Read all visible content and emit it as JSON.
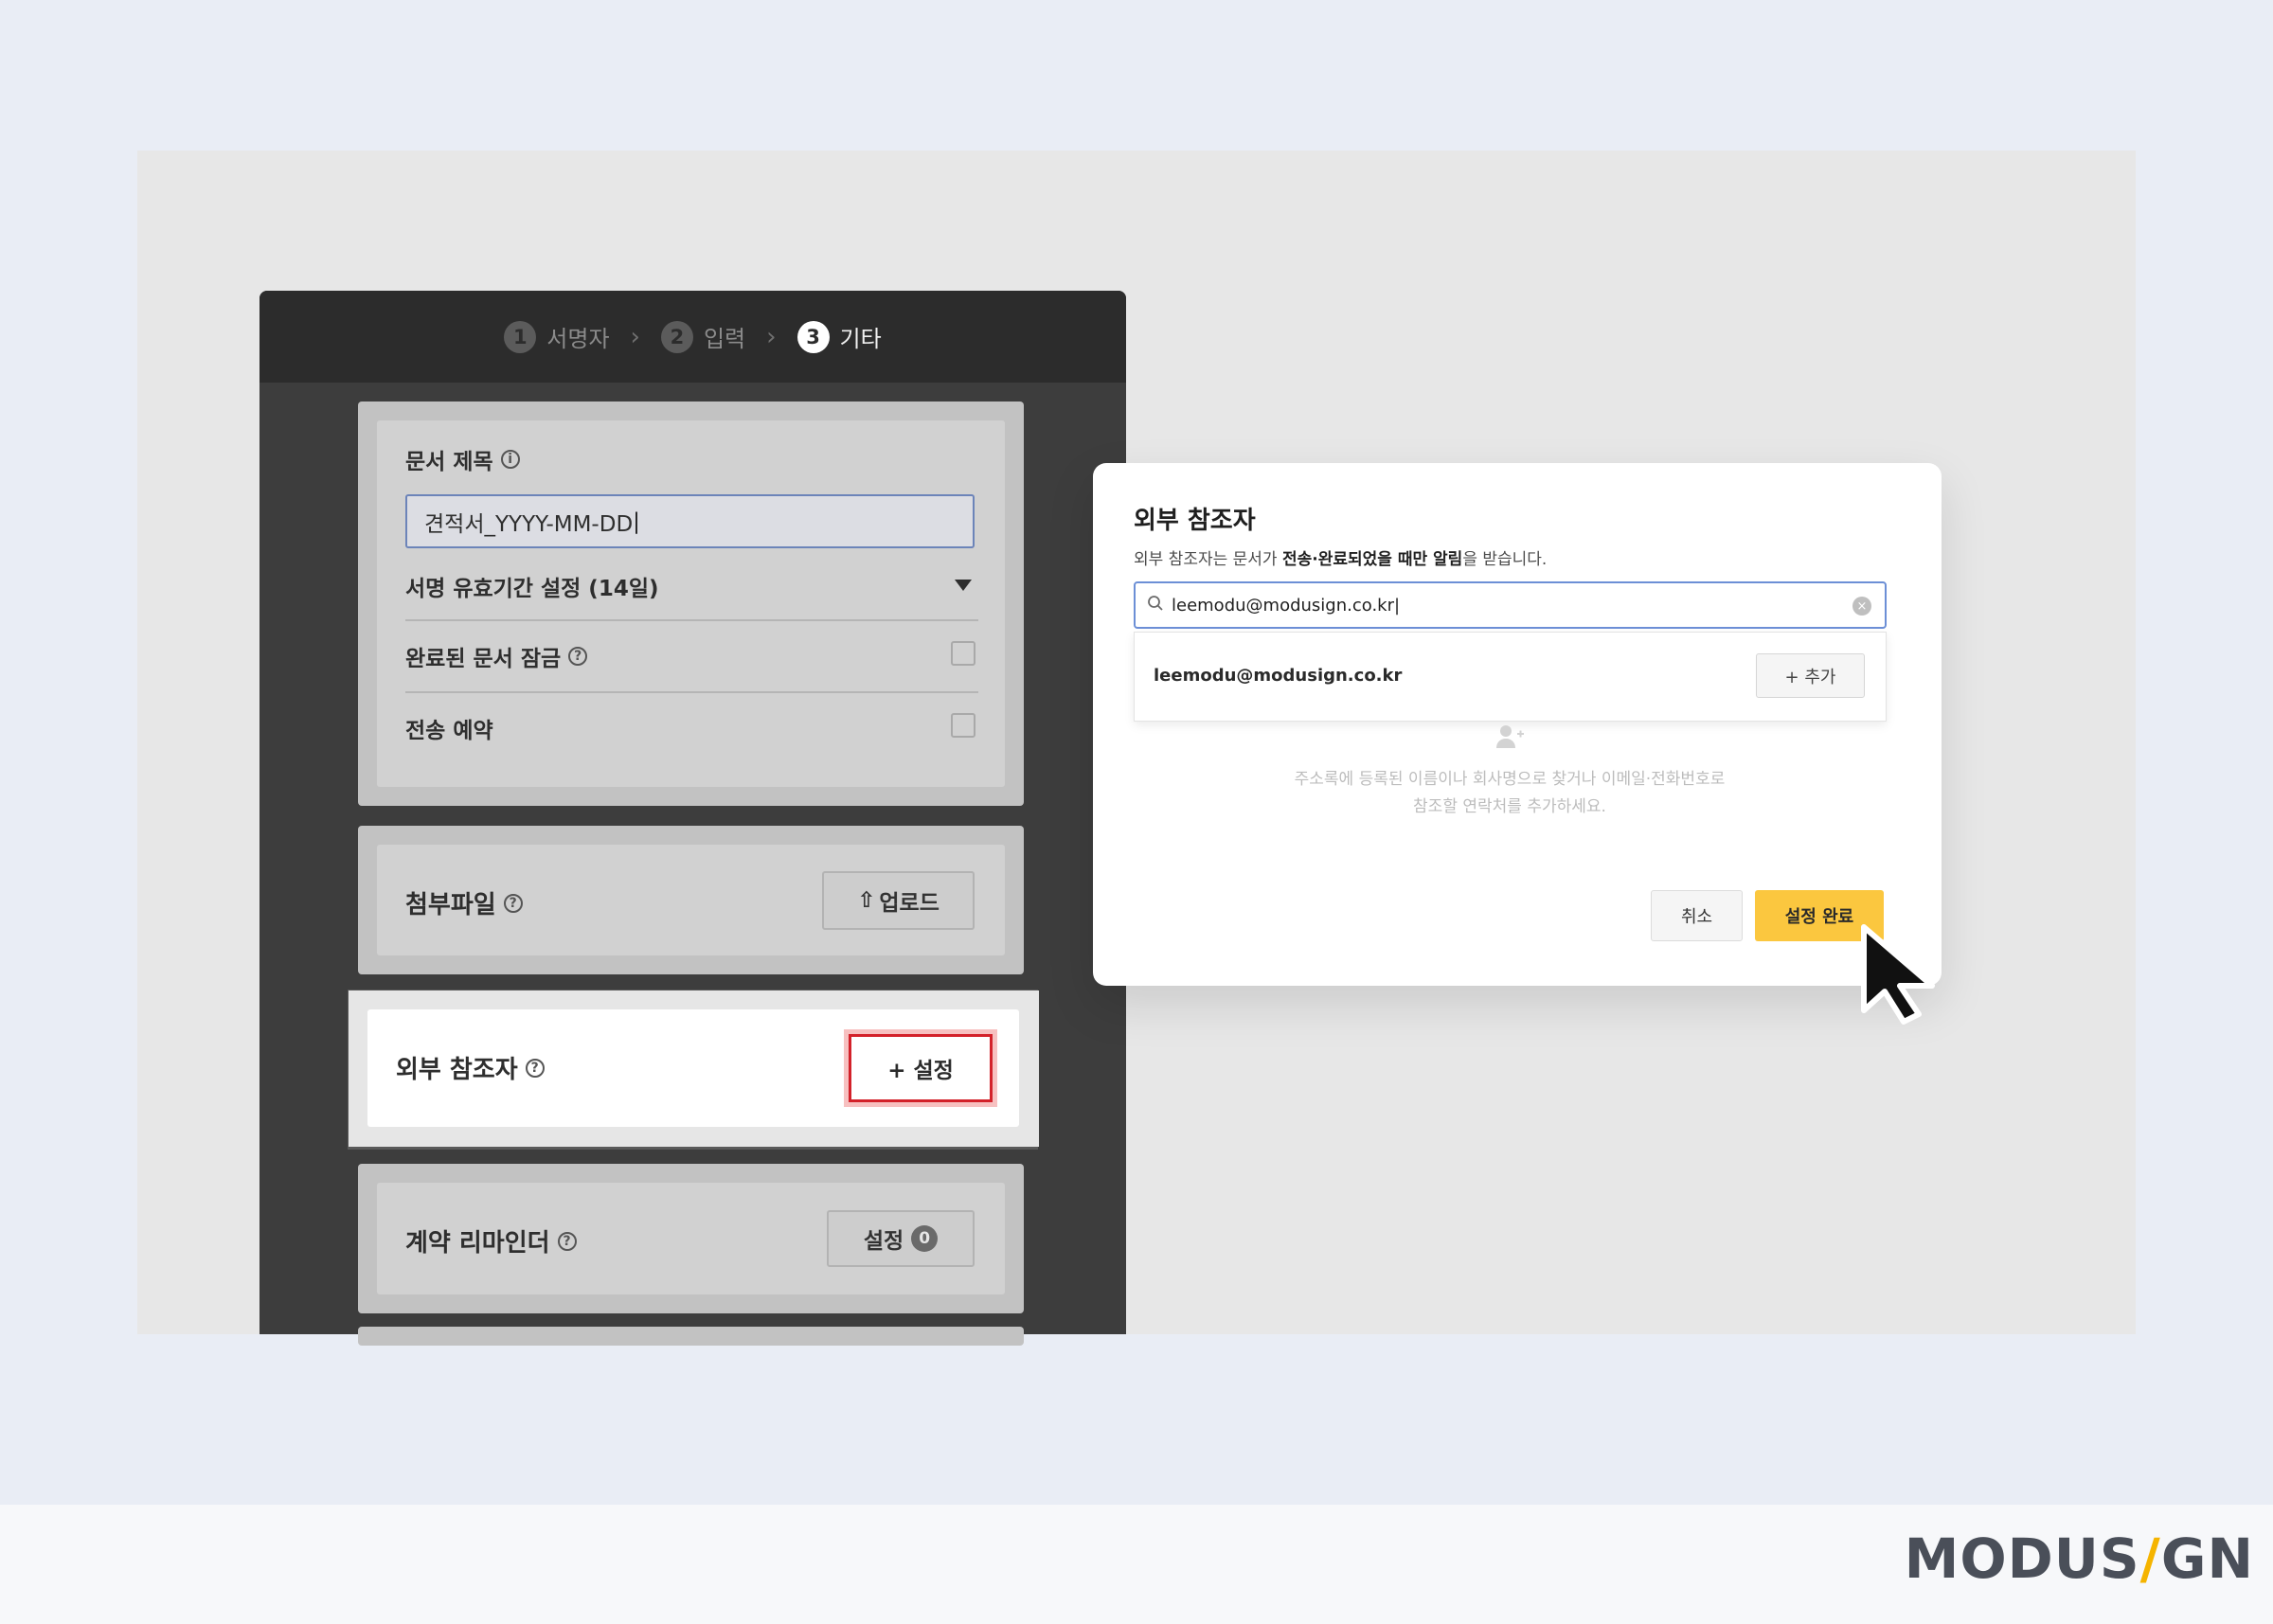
{
  "steps": [
    {
      "num": "1",
      "label": "서명자"
    },
    {
      "num": "2",
      "label": "입력"
    },
    {
      "num": "3",
      "label": "기타"
    }
  ],
  "doc_title": {
    "label": "문서 제목",
    "value": "견적서_YYYY-MM-DD"
  },
  "expiry": {
    "label": "서명 유효기간 설정 (14일)"
  },
  "lock_completed": {
    "label": "완료된 문서 잠금"
  },
  "schedule_send": {
    "label": "전송 예약"
  },
  "attachment": {
    "label": "첨부파일",
    "button": "업로드"
  },
  "external_ref": {
    "label": "외부 참조자",
    "button": "+ 설정"
  },
  "reminder": {
    "label": "계약 리마인더",
    "button": "설정",
    "count": "0"
  },
  "modal": {
    "title": "외부 참조자",
    "desc_prefix": "외부 참조자는 문서가 ",
    "desc_bold": "전송·완료되었을 때만 알림",
    "desc_suffix": "을 받습니다.",
    "search_value": "leemodu@modusign.co.kr",
    "result_email": "leemodu@modusign.co.kr",
    "add_button": "+ 추가",
    "empty_line1": "주소록에 등록된 이름이나 회사명으로 찾거나 이메일·전화번호로",
    "empty_line2": "참조할 연락처를 추가하세요.",
    "cancel": "취소",
    "confirm": "설정 완료"
  },
  "brand": {
    "left": "MODUS",
    "slash": "/",
    "right": "GN"
  },
  "colors": {
    "accent": "#fbc73f",
    "highlight": "#d3212a",
    "focus": "#6c8fd6"
  }
}
